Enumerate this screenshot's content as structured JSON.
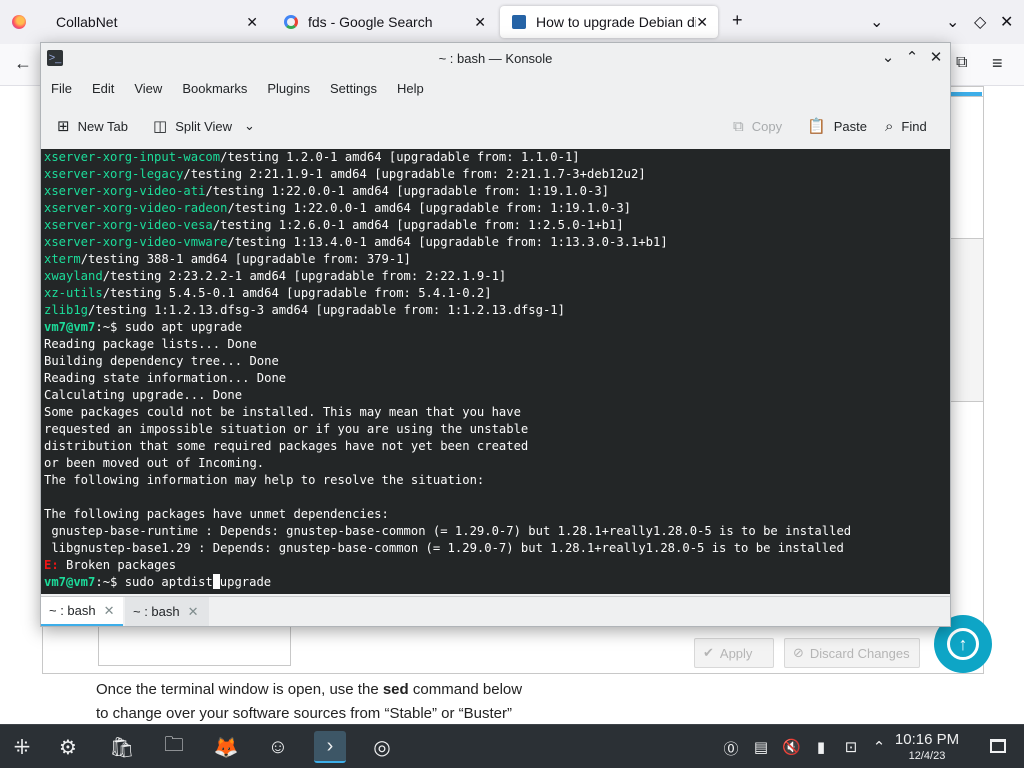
{
  "browser": {
    "tabs": [
      {
        "label": "CollabNet"
      },
      {
        "label": "fds - Google Search"
      },
      {
        "label": "How to upgrade Debian di"
      }
    ],
    "new_tab_icon": "+",
    "list_tabs_icon": "chevron-down-icon",
    "close_icon": "✕"
  },
  "page": {
    "apply_label": "Apply",
    "discard_label": "Discard Changes",
    "article_line1_before": "Once the terminal window is open, use the ",
    "article_line1_bold": "sed",
    "article_line1_after": " command below",
    "article_line2": "to change over your software sources from “Stable” or “Buster”"
  },
  "konsole": {
    "title": "~ : bash — Konsole",
    "menu": [
      "File",
      "Edit",
      "View",
      "Bookmarks",
      "Plugins",
      "Settings",
      "Help"
    ],
    "toolbar": {
      "new_tab": "New Tab",
      "split_view": "Split View",
      "copy": "Copy",
      "paste": "Paste",
      "find": "Find"
    },
    "terminal": {
      "pkg_lines": [
        {
          "pkg": "xserver-xorg-input-wacom",
          "rest": "/testing 1.2.0-1 amd64 [upgradable from: 1.1.0-1]"
        },
        {
          "pkg": "xserver-xorg-legacy",
          "rest": "/testing 2:21.1.9-1 amd64 [upgradable from: 2:21.1.7-3+deb12u2]"
        },
        {
          "pkg": "xserver-xorg-video-ati",
          "rest": "/testing 1:22.0.0-1 amd64 [upgradable from: 1:19.1.0-3]"
        },
        {
          "pkg": "xserver-xorg-video-radeon",
          "rest": "/testing 1:22.0.0-1 amd64 [upgradable from: 1:19.1.0-3]"
        },
        {
          "pkg": "xserver-xorg-video-vesa",
          "rest": "/testing 1:2.6.0-1 amd64 [upgradable from: 1:2.5.0-1+b1]"
        },
        {
          "pkg": "xserver-xorg-video-vmware",
          "rest": "/testing 1:13.4.0-1 amd64 [upgradable from: 1:13.3.0-3.1+b1]"
        },
        {
          "pkg": "xterm",
          "rest": "/testing 388-1 amd64 [upgradable from: 379-1]"
        },
        {
          "pkg": "xwayland",
          "rest": "/testing 2:23.2.2-1 amd64 [upgradable from: 2:22.1.9-1]"
        },
        {
          "pkg": "xz-utils",
          "rest": "/testing 5.4.5-0.1 amd64 [upgradable from: 5.4.1-0.2]"
        },
        {
          "pkg": "zlib1g",
          "rest": "/testing 1:1.2.13.dfsg-3 amd64 [upgradable from: 1:1.2.13.dfsg-1]"
        }
      ],
      "prompt": "vm7@vm7",
      "prompt_suffix": ":~$ ",
      "command1": "sudo apt upgrade",
      "output_lines": [
        "Reading package lists... Done",
        "Building dependency tree... Done",
        "Reading state information... Done",
        "Calculating upgrade... Done",
        "Some packages could not be installed. This may mean that you have",
        "requested an impossible situation or if you are using the unstable",
        "distribution that some required packages have not yet been created",
        "or been moved out of Incoming.",
        "The following information may help to resolve the situation:",
        "",
        "The following packages have unmet dependencies:",
        " gnustep-base-runtime : Depends: gnustep-base-common (= 1.29.0-7) but 1.28.1+really1.28.0-5 is to be installed",
        " libgnustep-base1.29 : Depends: gnustep-base-common (= 1.29.0-7) but 1.28.1+really1.28.0-5 is to be installed"
      ],
      "error_prefix": "E:",
      "error_text": " Broken packages",
      "command2_before": "sudo aptdist",
      "command2_after": "upgrade"
    },
    "tabs": [
      {
        "label": "~ : bash"
      },
      {
        "label": "~ : bash"
      }
    ]
  },
  "taskbar": {
    "time": "10:16 PM",
    "date": "12/4/23"
  },
  "colors": {
    "terminal_bg": "#232627",
    "terminal_green": "#1cdc9a",
    "terminal_red": "#ed1515",
    "accent": "#3daee9",
    "fab": "#0ea5c6"
  }
}
